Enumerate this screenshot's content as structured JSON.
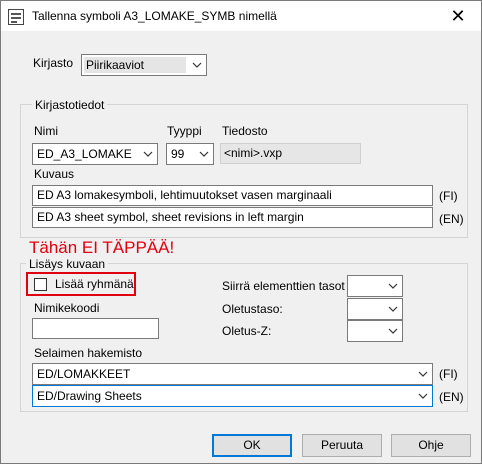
{
  "window": {
    "title": "Tallenna symboli A3_LOMAKE_SYMB nimellä",
    "close_glyph": "✕"
  },
  "library": {
    "label": "Kirjasto",
    "value": "Piirikaaviot"
  },
  "library_info": {
    "group_title": "Kirjastotiedot",
    "name_label": "Nimi",
    "name_value": "ED_A3_LOMAKE",
    "type_label": "Tyyppi",
    "type_value": "99",
    "file_label": "Tiedosto",
    "file_value": "<nimi>.vxp",
    "description_label": "Kuvaus",
    "description_fi": "ED A3 lomakesymboli, lehtimuutokset vasen marginaali",
    "description_en": "ED A3 sheet symbol, sheet revisions in left margin",
    "lang_fi": "(FI)",
    "lang_en": "(EN)"
  },
  "annotation": {
    "note": "Tähän EI TÄPPÄÄ!",
    "color": "#e0000f"
  },
  "add_to_image": {
    "group_title": "Lisäys kuvaan",
    "add_to_group_label": "Lisää ryhmänä",
    "add_to_group_checked": false,
    "move_layers_label": "Siirrä elementtien tasot",
    "default_layer_label": "Oletustaso:",
    "default_z_label": "Oletus-Z:",
    "short_code_label": "Nimikekoodi",
    "short_code_value": "",
    "browser_dir_label": "Selaimen hakemisto",
    "browser_dir_fi": "ED/LOMAKKEET",
    "browser_dir_en": "ED/Drawing Sheets",
    "lang_fi": "(FI)",
    "lang_en": "(EN)"
  },
  "buttons": {
    "ok": "OK",
    "cancel": "Peruuta",
    "help": "Ohje"
  },
  "colors": {
    "accent": "#0078d7",
    "window_bg": "#f0f0f0"
  }
}
